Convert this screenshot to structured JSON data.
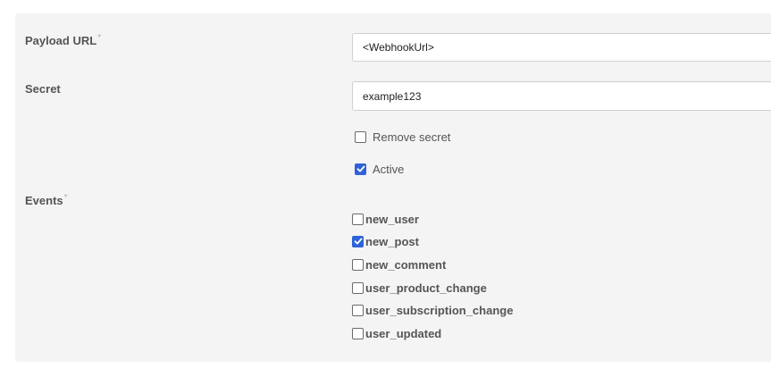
{
  "form": {
    "payload_url": {
      "label": "Payload URL",
      "required_mark": "*",
      "value": "<WebhookUrl>"
    },
    "secret": {
      "label": "Secret",
      "value": "example123"
    },
    "remove_secret": {
      "label": "Remove secret",
      "checked": false
    },
    "active": {
      "label": "Active",
      "checked": true
    },
    "events": {
      "label": "Events",
      "required_mark": "*",
      "items": [
        {
          "label": "new_user",
          "checked": false
        },
        {
          "label": "new_post",
          "checked": true
        },
        {
          "label": "new_comment",
          "checked": false
        },
        {
          "label": "user_product_change",
          "checked": false
        },
        {
          "label": "user_subscription_change",
          "checked": false
        },
        {
          "label": "user_updated",
          "checked": false
        }
      ]
    }
  },
  "colors": {
    "accent": "#2f62d8",
    "panel": "#f4f4f4",
    "label_text": "#555555"
  }
}
